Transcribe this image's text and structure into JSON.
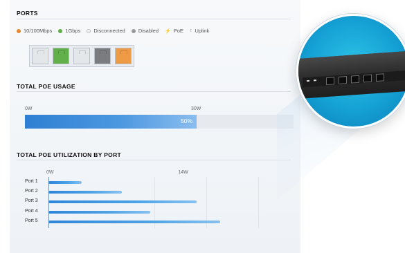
{
  "sections": {
    "ports": "PORTS",
    "poe_usage": "TOTAL POE USAGE",
    "poe_by_port": "TOTAL POE UTILIZATION BY PORT"
  },
  "legend": [
    {
      "label": "10/100Mbps",
      "color": "#e9862e",
      "kind": "dot"
    },
    {
      "label": "1Gbps",
      "color": "#5fb04a",
      "kind": "dot"
    },
    {
      "label": "Disconnected",
      "color": "#bfbfbf",
      "kind": "ring"
    },
    {
      "label": "Disabled",
      "color": "#9a9a9a",
      "kind": "dot"
    },
    {
      "label": "PoE",
      "icon": "bolt-icon",
      "glyph": "⚡"
    },
    {
      "label": "Uplink",
      "icon": "arrow-up-icon",
      "glyph": "↑"
    }
  ],
  "port_states": [
    {
      "state": "disconnected",
      "color": "#e4e7ea"
    },
    {
      "state": "1gbps",
      "color": "#62b04a"
    },
    {
      "state": "disconnected",
      "color": "#e4e7ea"
    },
    {
      "state": "disabled",
      "color": "#7a7c80"
    },
    {
      "state": "10/100mbps",
      "color": "#ef9a45"
    }
  ],
  "poe_usage": {
    "min_label": "0W",
    "mid_label": "30W",
    "percent_label": "50%",
    "fraction": 0.64
  },
  "chart_data": {
    "type": "bar",
    "orientation": "horizontal",
    "categories": [
      "Port 1",
      "Port 2",
      "Port 3",
      "Port 4",
      "Port 5"
    ],
    "values": [
      3.5,
      7.8,
      15.7,
      10.8,
      18.2
    ],
    "ticks": [
      "0W",
      "14W"
    ],
    "xlim": [
      0,
      25
    ]
  },
  "colors": {
    "bar": "#3a8fdc",
    "lens": "#14a0d4"
  }
}
